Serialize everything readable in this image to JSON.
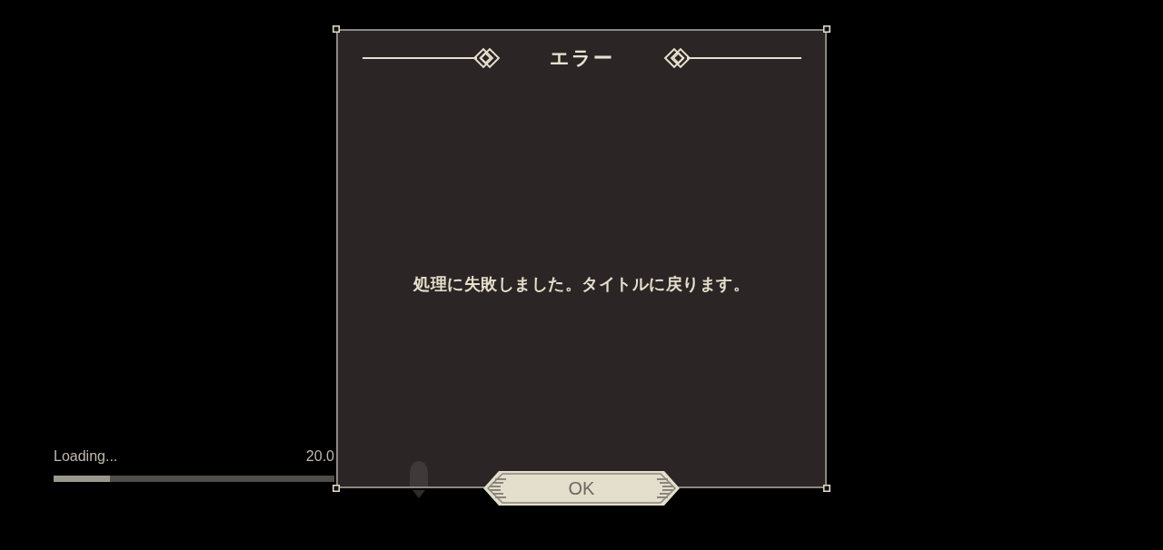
{
  "loading": {
    "label": "Loading...",
    "percent": "20.0",
    "level": 0.2
  },
  "dialog": {
    "title": "エラー",
    "message": "処理に失敗しました。タイトルに戻ります。",
    "buttons": [
      "OK"
    ]
  }
}
